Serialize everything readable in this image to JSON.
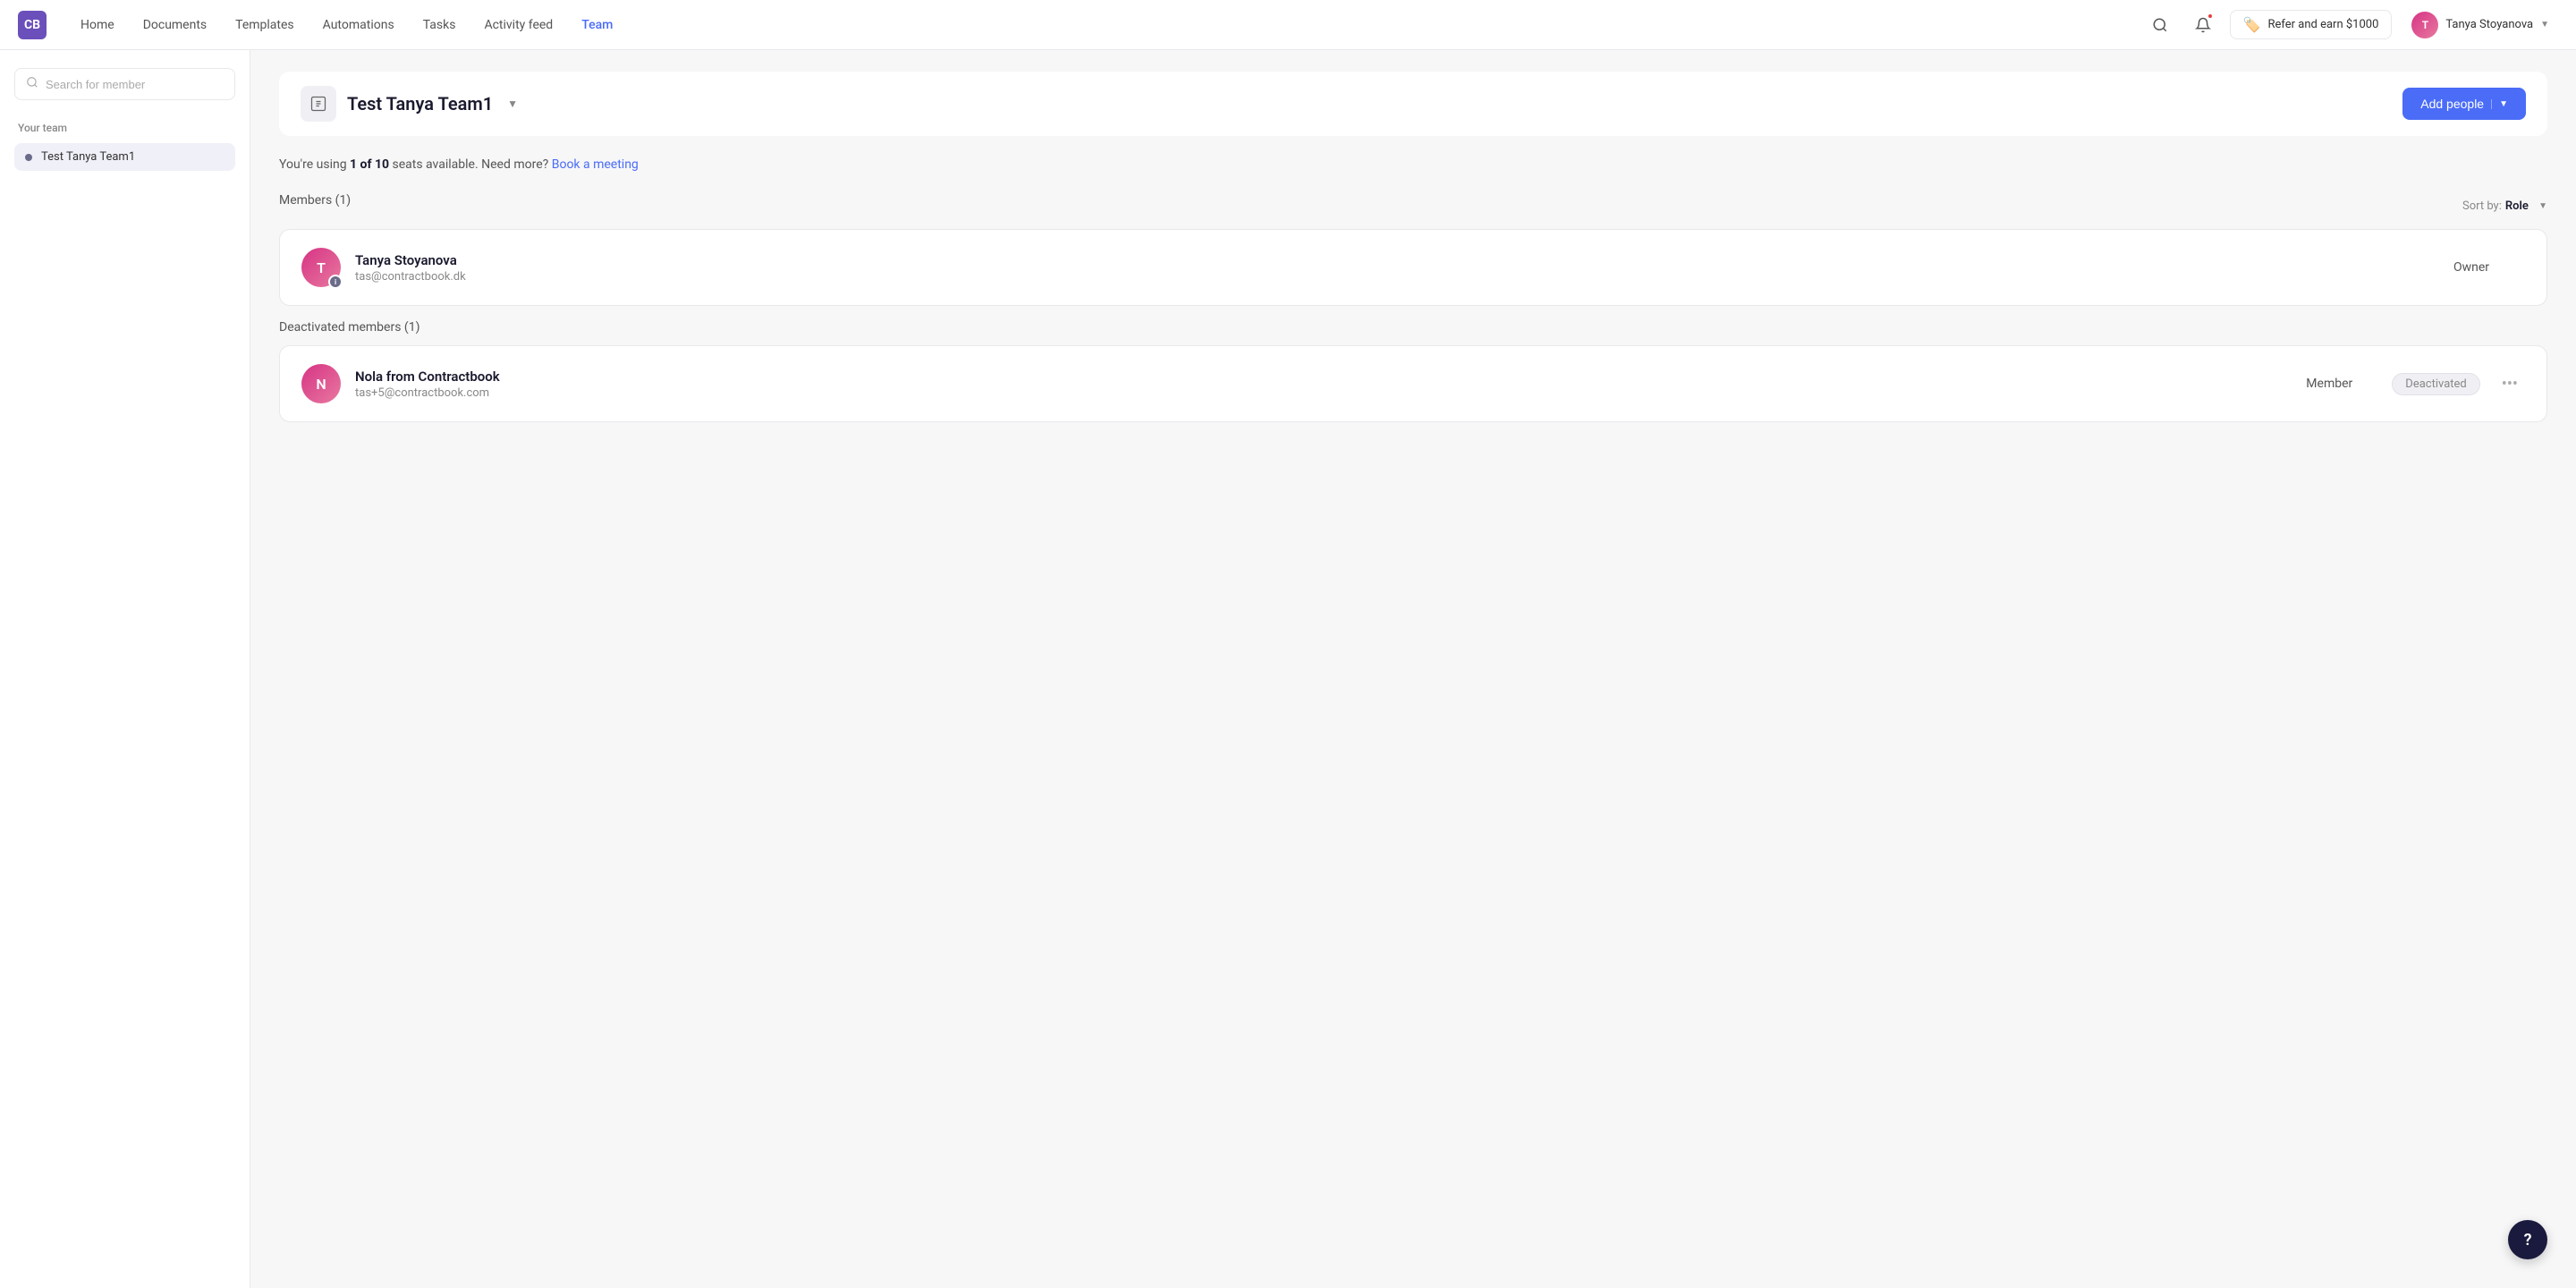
{
  "nav": {
    "logo_text": "CB",
    "links": [
      {
        "label": "Home",
        "active": false
      },
      {
        "label": "Documents",
        "active": false
      },
      {
        "label": "Templates",
        "active": false
      },
      {
        "label": "Automations",
        "active": false
      },
      {
        "label": "Tasks",
        "active": false
      },
      {
        "label": "Activity feed",
        "active": false
      },
      {
        "label": "Team",
        "active": true
      }
    ],
    "refer_label": "Refer and earn $1000",
    "user_name": "Tanya Stoyanova",
    "user_initials": "T"
  },
  "sidebar": {
    "search_placeholder": "Search for member",
    "section_label": "Your team",
    "items": [
      {
        "label": "Test Tanya Team1",
        "active": true
      }
    ]
  },
  "team": {
    "name": "Test Tanya Team1",
    "add_people_label": "Add people",
    "seats_text_prefix": "You're using ",
    "seats_bold": "1 of 10",
    "seats_text_suffix": " seats available. Need more?",
    "book_link_label": "Book a meeting",
    "members_title": "Members (1)",
    "sort_label": "Sort by: ",
    "sort_value": "Role",
    "deactivated_members_title": "Deactivated members (1)"
  },
  "members": [
    {
      "name": "Tanya Stoyanova",
      "email": "tas@contractbook.dk",
      "role": "Owner",
      "initials": "T",
      "avatar_class": "tanya",
      "has_info_badge": true,
      "deactivated": false
    }
  ],
  "deactivated_members": [
    {
      "name": "Nola from Contractbook",
      "email": "tas+5@contractbook.com",
      "role": "Member",
      "initials": "N",
      "avatar_class": "nola",
      "has_info_badge": false,
      "deactivated_label": "Deactivated"
    }
  ],
  "help": {
    "label": "?"
  }
}
